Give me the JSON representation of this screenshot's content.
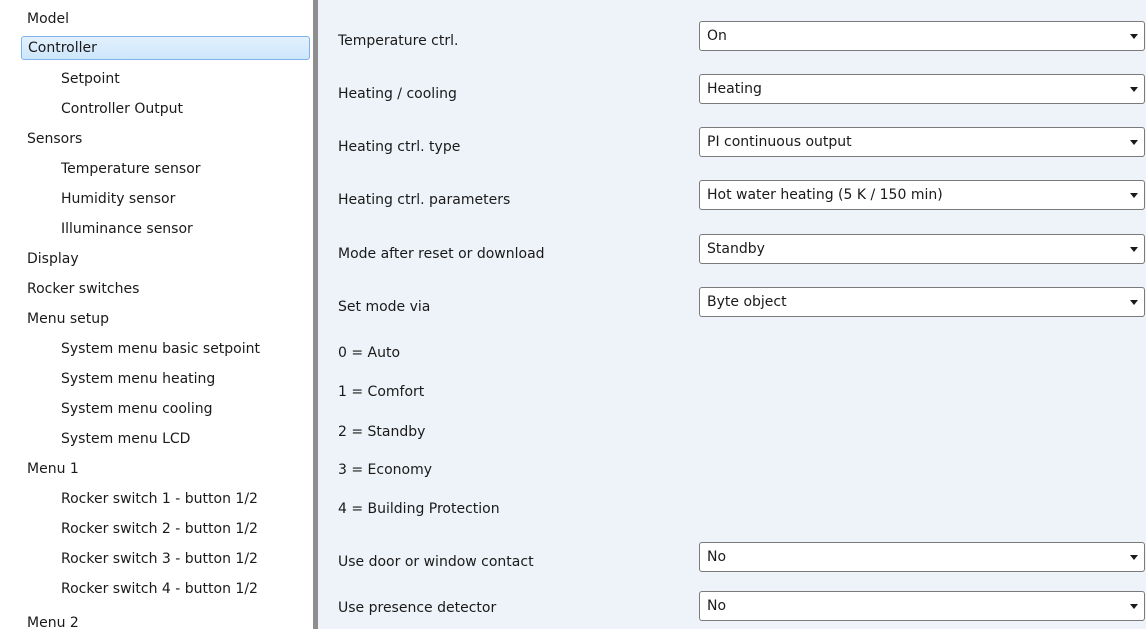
{
  "sidebar": {
    "items": [
      {
        "label": "Model",
        "level": 0
      },
      {
        "label": "Controller",
        "level": 0,
        "selected": true
      },
      {
        "label": "Setpoint",
        "level": 1
      },
      {
        "label": "Controller Output",
        "level": 1
      },
      {
        "label": "Sensors",
        "level": 0
      },
      {
        "label": "Temperature sensor",
        "level": 1
      },
      {
        "label": "Humidity sensor",
        "level": 1
      },
      {
        "label": "Illuminance sensor",
        "level": 1
      },
      {
        "label": "Display",
        "level": 0
      },
      {
        "label": "Rocker switches",
        "level": 0
      },
      {
        "label": "Menu setup",
        "level": 0
      },
      {
        "label": "System menu basic setpoint",
        "level": 1
      },
      {
        "label": "System menu heating",
        "level": 1
      },
      {
        "label": "System menu cooling",
        "level": 1
      },
      {
        "label": "System menu LCD",
        "level": 1
      },
      {
        "label": "Menu 1",
        "level": 0
      },
      {
        "label": "Rocker switch 1 - button 1/2",
        "level": 1
      },
      {
        "label": "Rocker switch 2 - button 1/2",
        "level": 1
      },
      {
        "label": "Rocker switch 3 - button 1/2",
        "level": 1
      },
      {
        "label": "Rocker switch 4 - button 1/2",
        "level": 1
      },
      {
        "label": "Menu 2",
        "level": 0
      }
    ]
  },
  "params": {
    "temperature_ctrl": {
      "label": "Temperature ctrl.",
      "value": "On"
    },
    "heating_cooling": {
      "label": "Heating / cooling",
      "value": "Heating"
    },
    "heating_ctrl_type": {
      "label": "Heating ctrl. type",
      "value": "PI continuous output"
    },
    "heating_ctrl_parameters": {
      "label": "Heating ctrl. parameters",
      "value": "Hot water heating (5 K / 150 min)"
    },
    "mode_after_reset": {
      "label": "Mode after reset or download",
      "value": "Standby"
    },
    "set_mode_via": {
      "label": "Set mode via",
      "value": "Byte object"
    },
    "door_window_contact": {
      "label": "Use door or window contact",
      "value": "No"
    },
    "presence_detector": {
      "label": "Use presence detector",
      "value": "No"
    }
  },
  "mode_info": [
    "0 = Auto",
    "1 = Comfort",
    "2 = Standby",
    "3 = Economy",
    "4 = Building Protection"
  ],
  "colors": {
    "selection_bg": "#cde6fb",
    "selection_border": "#7eb4ea",
    "pane_bg": "#eef3f9",
    "splitter": "#8e8e8e"
  }
}
